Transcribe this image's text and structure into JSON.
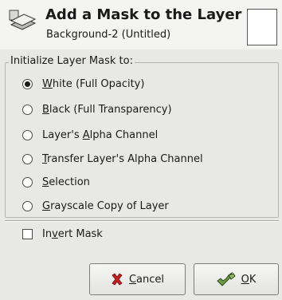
{
  "header": {
    "title": "Add a Mask to the Layer",
    "subtitle": "Background-2 (Untitled)",
    "icon": "layer-mask-icon"
  },
  "init_group": {
    "label": "Initialize Layer Mask to:",
    "selected": "White (Full Opacity)",
    "options": [
      {
        "pre": "",
        "key": "W",
        "post": "hite (Full Opacity)"
      },
      {
        "pre": "",
        "key": "B",
        "post": "lack (Full Transparency)"
      },
      {
        "pre": "Layer's ",
        "key": "A",
        "post": "lpha Channel"
      },
      {
        "pre": "",
        "key": "T",
        "post": "ransfer Layer's Alpha Channel"
      },
      {
        "pre": "",
        "key": "S",
        "post": "election"
      },
      {
        "pre": "",
        "key": "G",
        "post": "rayscale Copy of Layer"
      }
    ]
  },
  "invert": {
    "pre": "In",
    "key": "v",
    "post": "ert Mask",
    "checked": false
  },
  "buttons": {
    "cancel": {
      "key": "C",
      "post": "ancel",
      "icon": "cancel-x-icon"
    },
    "ok": {
      "key": "O",
      "post": "K",
      "icon": "ok-check-icon"
    }
  },
  "colors": {
    "background": "#e8e8e7",
    "header_background": "#f4f4f3",
    "cancel_icon": "#c62020",
    "ok_icon": "#5e8a3a"
  }
}
